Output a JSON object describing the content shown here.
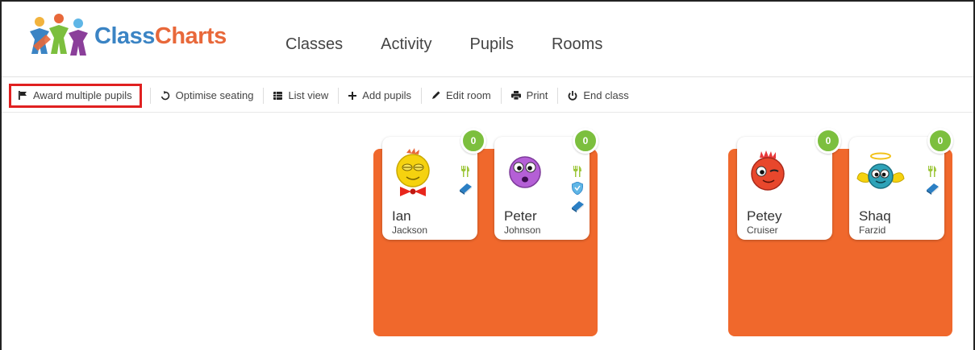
{
  "app": {
    "logo_part1": "Class",
    "logo_part2": "Charts",
    "nav": [
      "Classes",
      "Activity",
      "Pupils",
      "Rooms"
    ]
  },
  "toolbar": {
    "award": "Award multiple pupils",
    "optimise": "Optimise seating",
    "list_view": "List view",
    "add_pupils": "Add pupils",
    "edit_room": "Edit room",
    "print": "Print",
    "end_class": "End class"
  },
  "colors": {
    "table": "#f0682c",
    "badge": "#7cbf3e",
    "highlight": "#e02020",
    "logo_blue": "#3b84c4",
    "logo_orange": "#e8683a"
  },
  "pupils": [
    {
      "first": "Ian",
      "last": "Jackson",
      "points": "0",
      "avatar": "yellow-bowtie-avatar",
      "icons": [
        "fork-knife-icon",
        "book-icon"
      ]
    },
    {
      "first": "Peter",
      "last": "Johnson",
      "points": "0",
      "avatar": "purple-worried-avatar",
      "icons": [
        "fork-knife-icon",
        "shield-icon",
        "book-icon"
      ]
    },
    {
      "first": "Petey",
      "last": "Cruiser",
      "points": "0",
      "avatar": "red-winking-avatar",
      "icons": []
    },
    {
      "first": "Shaq",
      "last": "Farzid",
      "points": "0",
      "avatar": "blue-angel-avatar",
      "icons": [
        "fork-knife-icon",
        "book-icon"
      ]
    }
  ]
}
